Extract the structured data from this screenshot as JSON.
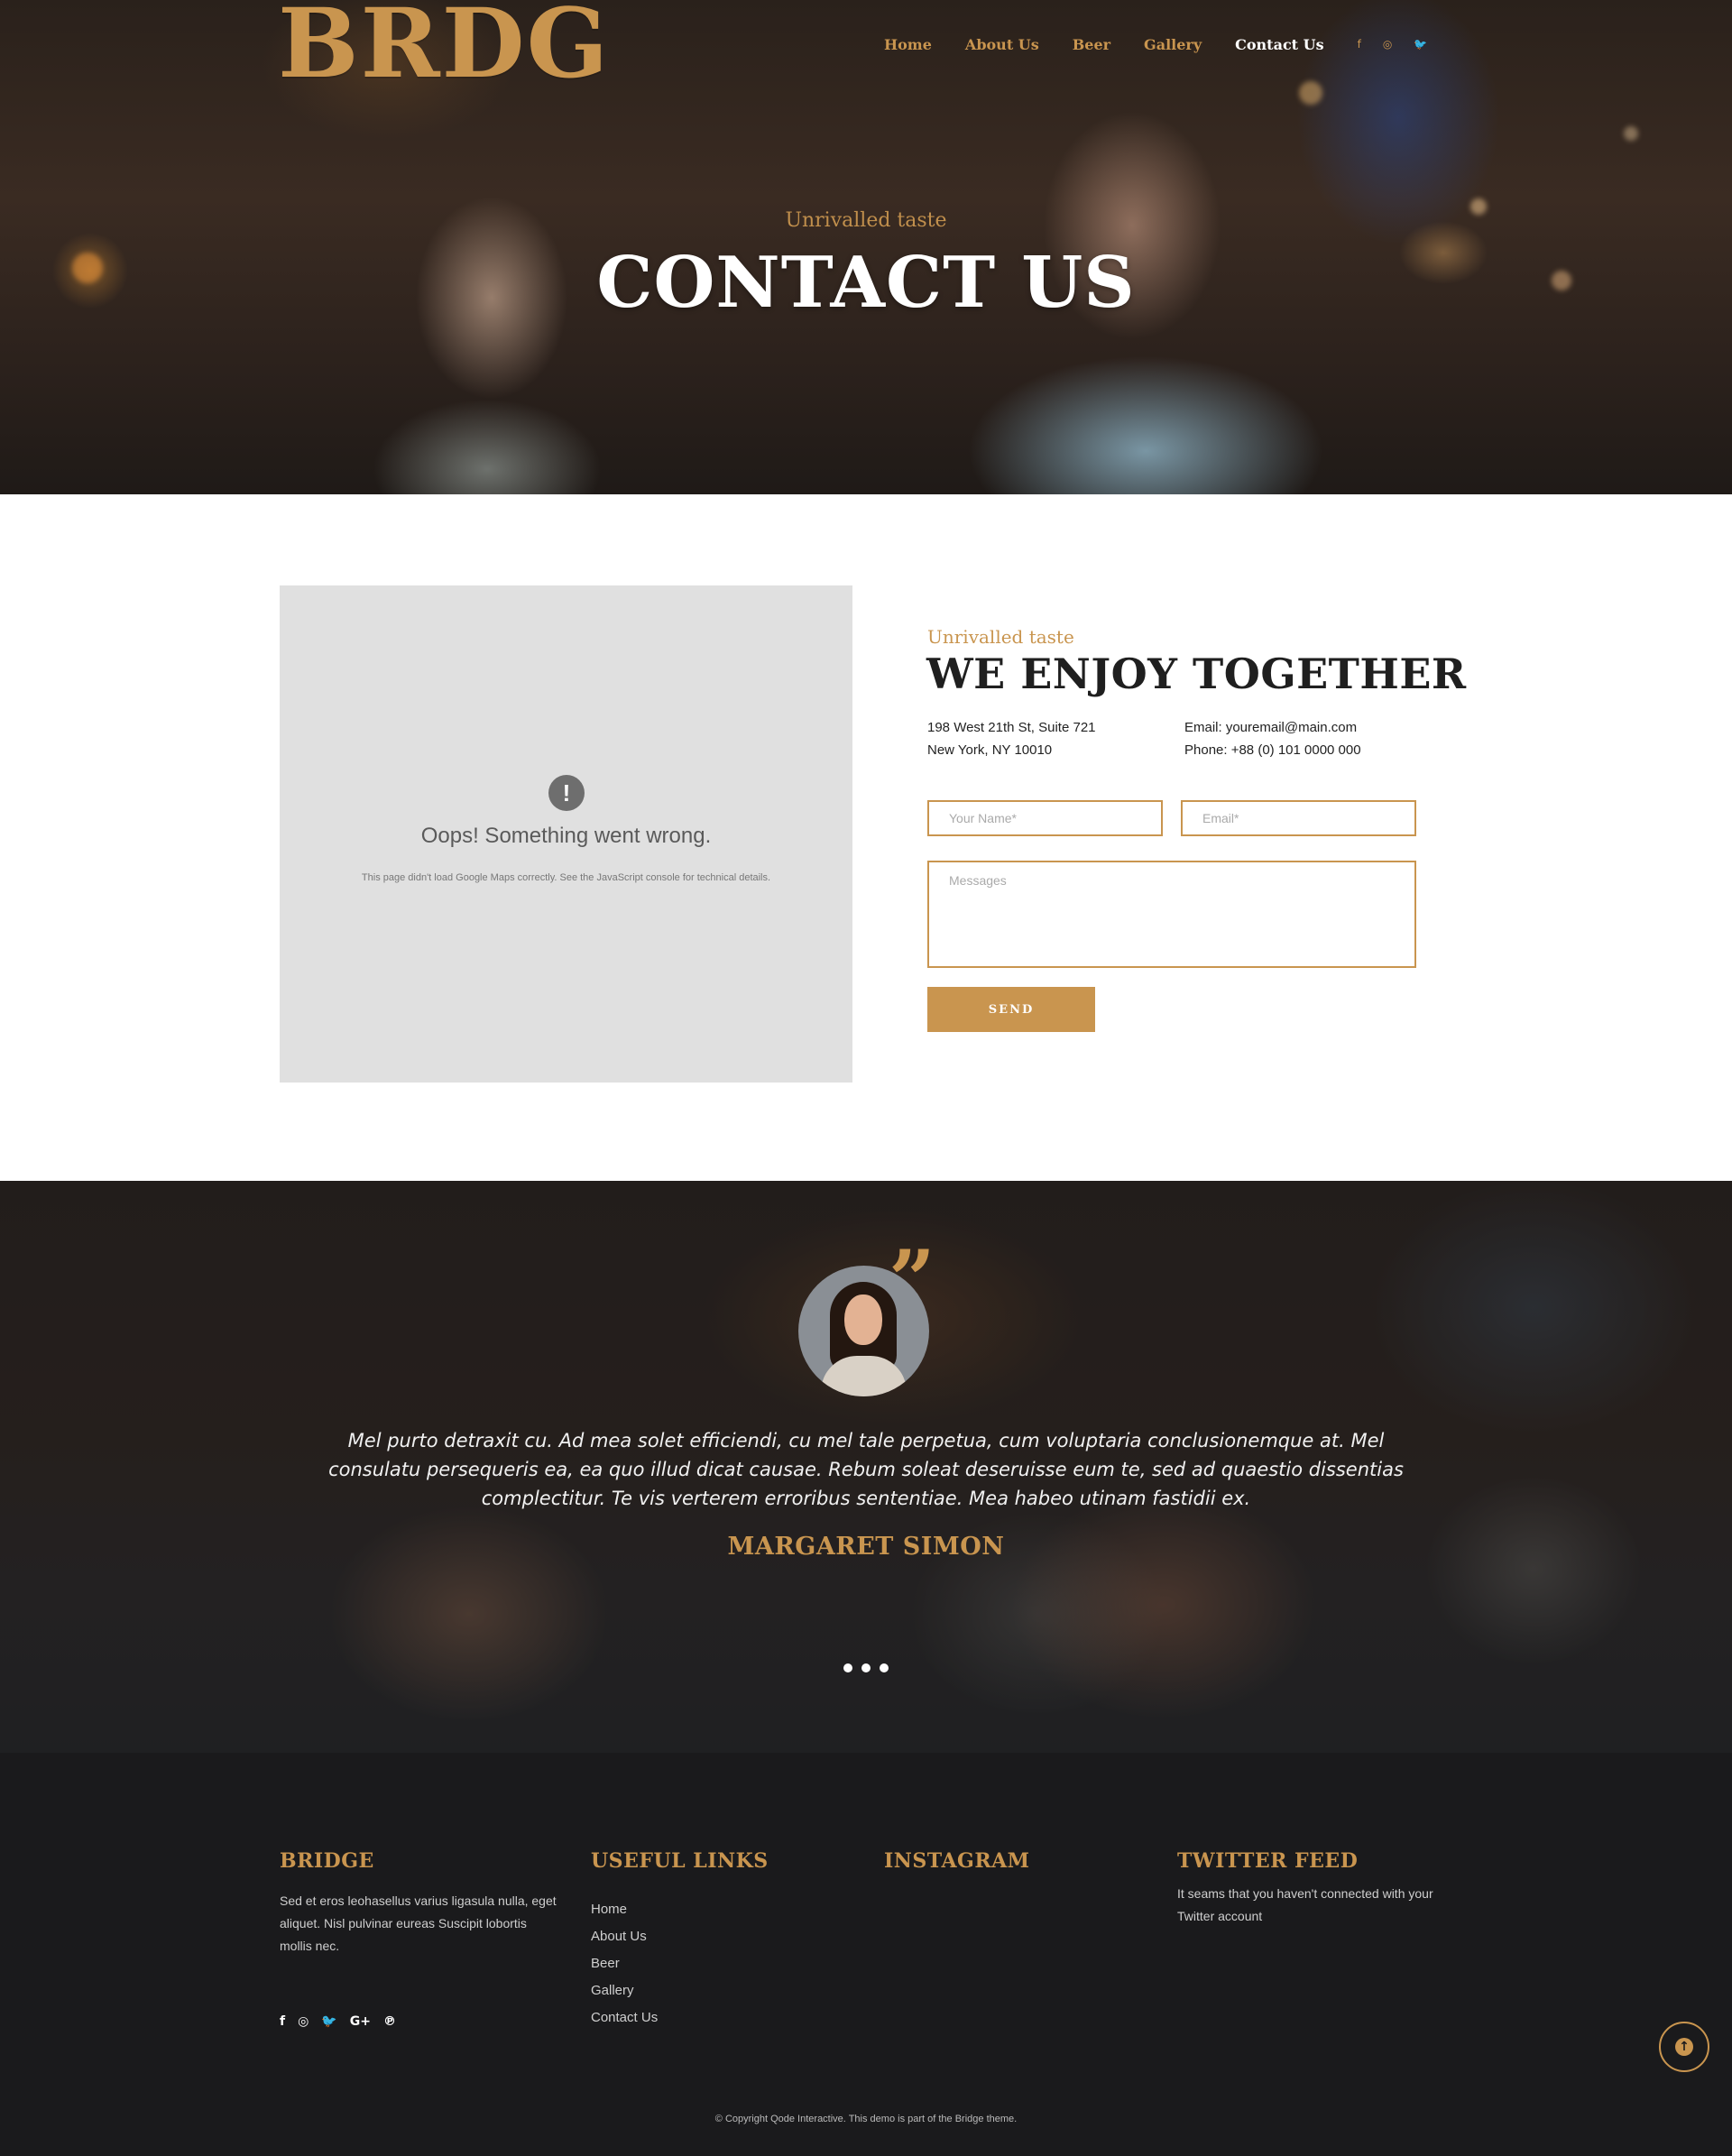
{
  "header": {
    "logo": "BRDG",
    "nav": [
      {
        "label": "Home"
      },
      {
        "label": "About Us"
      },
      {
        "label": "Beer"
      },
      {
        "label": "Gallery"
      },
      {
        "label": "Contact Us",
        "active": true
      }
    ],
    "social_icons": [
      "facebook-icon",
      "instagram-icon",
      "twitter-icon"
    ],
    "social_glyphs": [
      "f",
      "◎",
      "🐦"
    ]
  },
  "hero": {
    "subtitle": "Unrivalled taste",
    "title": "CONTACT US"
  },
  "map": {
    "error_title": "Oops! Something went wrong.",
    "error_text": "This page didn't load Google Maps correctly. See the JavaScript console for technical details.",
    "warning_glyph": "!"
  },
  "contact": {
    "subtitle": "Unrivalled taste",
    "title": "WE ENJOY TOGETHER",
    "address_line1": "198 West 21th St, Suite 721",
    "address_line2": "New York, NY 10010",
    "email_line": "Email: youremail@main.com",
    "phone_line": "Phone: +88 (0) 101 0000 000",
    "form": {
      "name_placeholder": "Your Name*",
      "email_placeholder": "Email*",
      "message_placeholder": "Messages",
      "send_label": "SEND"
    }
  },
  "testimonial": {
    "quote_glyph": "”",
    "text": "Mel purto detraxit cu. Ad mea solet efficiendi, cu mel tale perpetua, cum voluptaria conclusionemque at. Mel consulatu persequeris ea, ea quo illud dicat causae. Rebum soleat deseruisse eum te, sed ad quaestio dissentias complectitur. Te vis verterem erroribus sententiae. Mea habeo utinam fastidii ex.",
    "name": "MARGARET SIMON",
    "slide_count": 3
  },
  "footer": {
    "bridge": {
      "title": "BRIDGE",
      "text": "Sed et eros leohasellus varius ligasula nulla, eget aliquet. Nisl pulvinar eureas Suscipit lobortis mollis nec."
    },
    "useful_links": {
      "title": "USEFUL LINKS",
      "links": [
        "Home",
        "About Us",
        "Beer",
        "Gallery",
        "Contact Us"
      ]
    },
    "instagram": {
      "title": "INSTAGRAM"
    },
    "twitter": {
      "title": "TWITTER FEED",
      "text": "It seams that you haven't connected with your Twitter account"
    },
    "social_icons": [
      "facebook-icon",
      "instagram-icon",
      "twitter-icon",
      "google-plus-icon",
      "pinterest-icon"
    ],
    "social_glyphs": [
      "f",
      "◎",
      "🐦",
      "G+",
      "℗"
    ],
    "copyright": "© Copyright Qode Interactive. This demo is part of the Bridge theme.",
    "back_to_top_glyph": "↑"
  },
  "colors": {
    "accent": "#c9954f",
    "dark": "#1a1a1c",
    "map_bg": "#e0e0e0"
  }
}
